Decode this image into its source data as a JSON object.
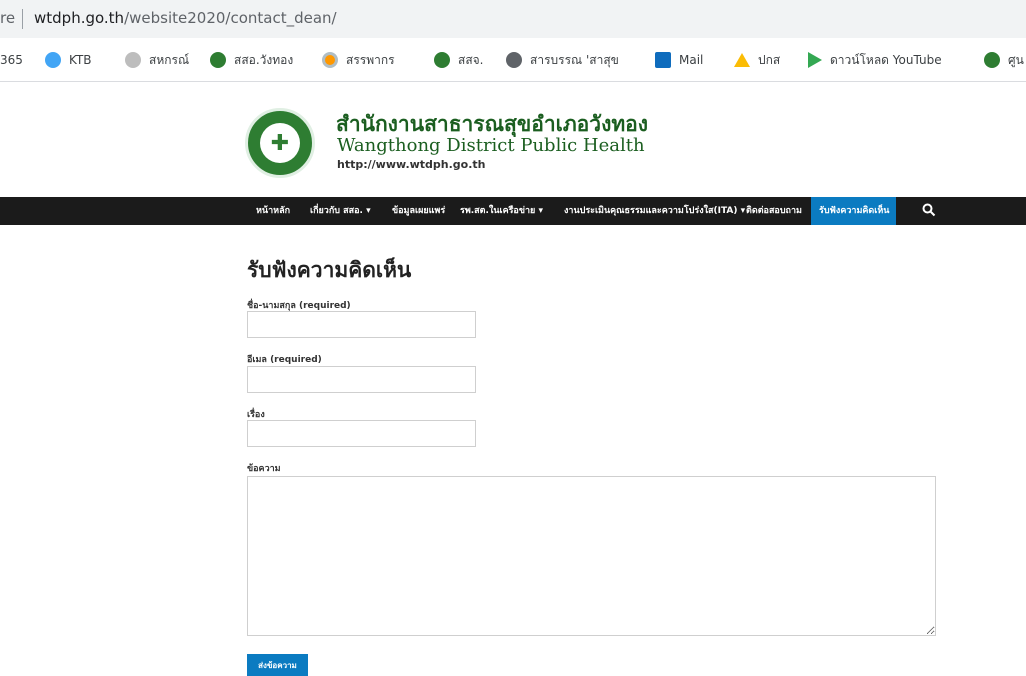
{
  "browser": {
    "secure_text": "re",
    "url_host": "wtdph.go.th",
    "url_path": "/website2020/contact_dean/"
  },
  "bookmarks": [
    {
      "label": "365",
      "icon": "office-icon"
    },
    {
      "label": "KTB",
      "icon": "ktb-icon"
    },
    {
      "label": "สหกรณ์",
      "icon": "coop-icon"
    },
    {
      "label": "สสอ.วังทอง",
      "icon": "moph-icon"
    },
    {
      "label": "สรรพากร",
      "icon": "revenue-icon"
    },
    {
      "label": "สสจ.",
      "icon": "moph-icon"
    },
    {
      "label": "สารบรรณ 'สาสุข",
      "icon": "globe-icon"
    },
    {
      "label": "Mail",
      "icon": "outlook-icon"
    },
    {
      "label": "ปกส",
      "icon": "triangle-icon"
    },
    {
      "label": "ดาวน์โหลด YouTube",
      "icon": "play-icon"
    },
    {
      "label": "ศูน",
      "icon": "moph-icon"
    }
  ],
  "site": {
    "name_thai": "สำนักงานสาธารณสุขอำเภอวังทอง",
    "name_en": "Wangthong District Public Health",
    "url": "http://www.wtdph.go.th"
  },
  "nav": {
    "items": [
      {
        "label": "หน้าหลัก"
      },
      {
        "label": "เกี่ยวกับ สสอ. ▾"
      },
      {
        "label": "ข้อมูลเผยแพร่"
      },
      {
        "label": "รพ.สต.ในเครือข่าย ▾"
      },
      {
        "label": "งานประเมินคุณธรรมและความโปร่งใส(ITA) ▾"
      },
      {
        "label": "ติดต่อสอบถาม"
      },
      {
        "label": "รับฟังความคิดเห็น"
      }
    ]
  },
  "form": {
    "title": "รับฟังความคิดเห็น",
    "name_label": "ชื่อ-นามสกุล (required)",
    "email_label": "อีเมล (required)",
    "subject_label": "เรื่อง",
    "message_label": "ข้อความ",
    "submit_label": "ส่งข้อความ"
  }
}
